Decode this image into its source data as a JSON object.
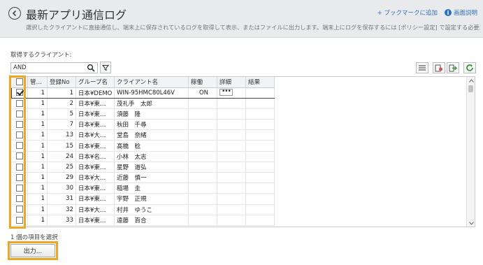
{
  "header": {
    "title": "最新アプリ通信ログ",
    "description": "選択したクライアントに直接通信し、端末上に保存されているログを取得して表示、またはファイルに出力します。端末上にログを保存するには [ポリシー設定] で設定する必要があ…",
    "bookmark_link": "+ ブックマークに追加",
    "help_link": "画面説明"
  },
  "filter": {
    "label": "取得するクライアント:",
    "search_value": "AND"
  },
  "table": {
    "columns": [
      "管…",
      "登録No",
      "グループ名",
      "クライアント名",
      "稼働",
      "詳細",
      "結果"
    ],
    "rows": [
      {
        "mgmt": "1",
        "no": "1",
        "group": "日本¥DEMO",
        "client": "WIN-95HMC80L46V",
        "status": "ON",
        "detail": "•••",
        "result": "",
        "checked": true
      },
      {
        "mgmt": "1",
        "no": "2",
        "group": "日本¥東…",
        "client": "茂礼手　太郎",
        "status": "",
        "detail": "",
        "result": "",
        "checked": false
      },
      {
        "mgmt": "1",
        "no": "5",
        "group": "日本¥東…",
        "client": "須藤　隆",
        "status": "",
        "detail": "",
        "result": "",
        "checked": false
      },
      {
        "mgmt": "1",
        "no": "7",
        "group": "日本¥東…",
        "client": "秋田　千尋",
        "status": "",
        "detail": "",
        "result": "",
        "checked": false
      },
      {
        "mgmt": "1",
        "no": "13",
        "group": "日本¥大…",
        "client": "堂島　奈緒",
        "status": "",
        "detail": "",
        "result": "",
        "checked": false
      },
      {
        "mgmt": "1",
        "no": "15",
        "group": "日本¥東…",
        "client": "髙橋　稔",
        "status": "",
        "detail": "",
        "result": "",
        "checked": false
      },
      {
        "mgmt": "1",
        "no": "24",
        "group": "日本¥名…",
        "client": "小林　太志",
        "status": "",
        "detail": "",
        "result": "",
        "checked": false
      },
      {
        "mgmt": "1",
        "no": "25",
        "group": "日本¥東…",
        "client": "星野　道弘",
        "status": "",
        "detail": "",
        "result": "",
        "checked": false
      },
      {
        "mgmt": "1",
        "no": "29",
        "group": "日本¥大…",
        "client": "近藤　慎一",
        "status": "",
        "detail": "",
        "result": "",
        "checked": false
      },
      {
        "mgmt": "1",
        "no": "30",
        "group": "日本¥東…",
        "client": "稲場　圭",
        "status": "",
        "detail": "",
        "result": "",
        "checked": false
      },
      {
        "mgmt": "1",
        "no": "31",
        "group": "日本¥東…",
        "client": "宇野　正規",
        "status": "",
        "detail": "",
        "result": "",
        "checked": false
      },
      {
        "mgmt": "1",
        "no": "32",
        "group": "日本¥大…",
        "client": "村井　ゆうこ",
        "status": "",
        "detail": "",
        "result": "",
        "checked": false
      },
      {
        "mgmt": "1",
        "no": "33",
        "group": "日本¥東…",
        "client": "遠藤　百合",
        "status": "",
        "detail": "",
        "result": "",
        "checked": false
      }
    ]
  },
  "footer": {
    "selected_text": "1 個の項目を選択",
    "output_button": "出力..."
  },
  "colors": {
    "highlight": "#f0a623",
    "link": "#2b6fc2"
  }
}
